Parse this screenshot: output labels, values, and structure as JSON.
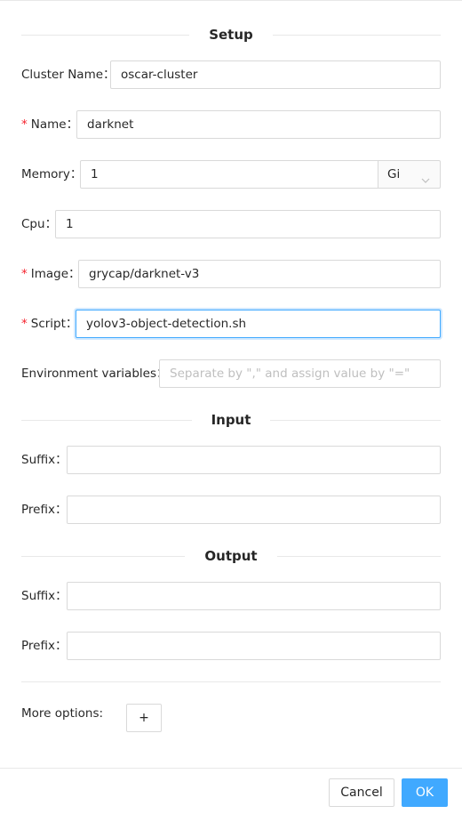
{
  "sections": {
    "setup": "Setup",
    "input": "Input",
    "output": "Output"
  },
  "fields": {
    "cluster_name": {
      "label": "Cluster Name",
      "value": "oscar-cluster"
    },
    "name": {
      "label": "Name",
      "value": "darknet",
      "required_mark": "*"
    },
    "memory": {
      "label": "Memory",
      "value": "1",
      "unit": "Gi"
    },
    "cpu": {
      "label": "Cpu",
      "value": "1"
    },
    "image": {
      "label": "Image",
      "value": "grycap/darknet-v3",
      "required_mark": "*"
    },
    "script": {
      "label": "Script",
      "value": "yolov3-object-detection.sh",
      "required_mark": "*"
    },
    "env": {
      "label": "Environment variables",
      "placeholder": "Separate by \",\" and assign value by \"=\""
    }
  },
  "input": {
    "suffix": {
      "label": "Suffix",
      "value": ""
    },
    "prefix": {
      "label": "Prefix",
      "value": ""
    }
  },
  "output": {
    "suffix": {
      "label": "Suffix",
      "value": ""
    },
    "prefix": {
      "label": "Prefix",
      "value": ""
    }
  },
  "more_options": {
    "label": "More options:",
    "button": "+"
  },
  "footer": {
    "cancel": "Cancel",
    "ok": "OK"
  },
  "colors": {
    "accent": "#40a9ff",
    "required": "#f5222d",
    "border": "#d9d9d9",
    "divider": "#e8e8e8"
  },
  "label_colon": "："
}
